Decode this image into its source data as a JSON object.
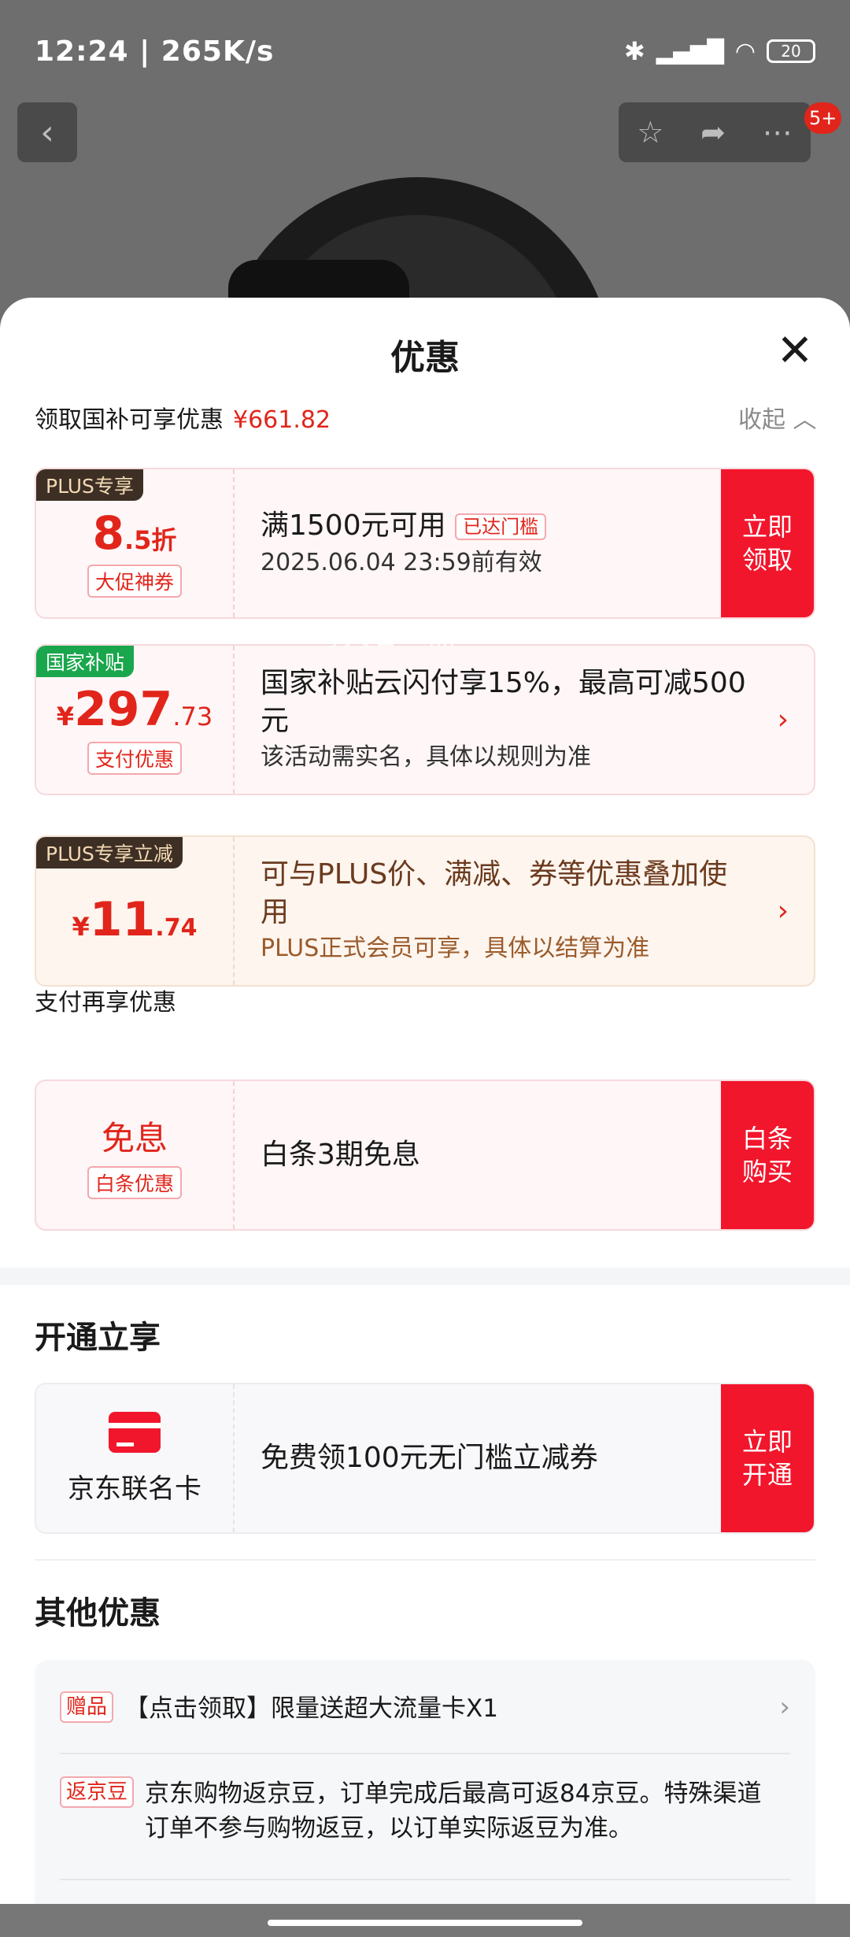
{
  "status": {
    "time": "12:24 | 265K/s",
    "battery": "20"
  },
  "nav": {
    "badge": "5+"
  },
  "sheet": {
    "title": "优惠",
    "subtitle": "领取国补可享优惠",
    "subtitle_amount": "¥661.82",
    "collapse": "收起"
  },
  "coupons": [
    {
      "tag": "PLUS专享",
      "value_main": "8",
      "value_unit": ".5折",
      "chip": "大促神券",
      "line1": "满1500元可用",
      "line1_chip": "已达门槛",
      "line2": "2025.06.04 23:59前有效",
      "action": "立即\n领取"
    },
    {
      "tag": "国家补贴",
      "value_prefix": "¥",
      "value_main": "297",
      "value_unit": ".73",
      "chip": "支付优惠",
      "line1": "国家补贴云闪付享15%，最高可减500元",
      "line2": "该活动需实名，具体以规则为准"
    },
    {
      "tag": "PLUS专享立减",
      "value_prefix": "¥",
      "value_main": "11",
      "value_unit": ".74",
      "line1": "可与PLUS价、满减、券等优惠叠加使用",
      "line2": "PLUS正式会员可享，具体以结算为准"
    }
  ],
  "pay_section": {
    "title": "支付再享优惠",
    "value": "免息",
    "chip": "白条优惠",
    "line1": "白条3期免息",
    "action": "白条\n购买"
  },
  "open_section": {
    "title": "开通立享",
    "card_name": "京东联名卡",
    "line1": "免费领100元无门槛立减券",
    "action": "立即\n开通"
  },
  "other_section": {
    "title": "其他优惠",
    "rows": [
      {
        "tag": "赠品",
        "text": "【点击领取】限量送超大流量卡X1"
      },
      {
        "tag": "返京豆",
        "text": "京东购物返京豆，订单完成后最高可返84京豆。特殊渠道订单不参与购物返豆，以订单实际返豆为准。"
      }
    ]
  },
  "watermark": "每天省一点",
  "colors": {
    "accent": "#e1251b",
    "action": "#f2162c",
    "plus_tag": "#3d2f24",
    "gov_tag": "#1aa64c"
  }
}
